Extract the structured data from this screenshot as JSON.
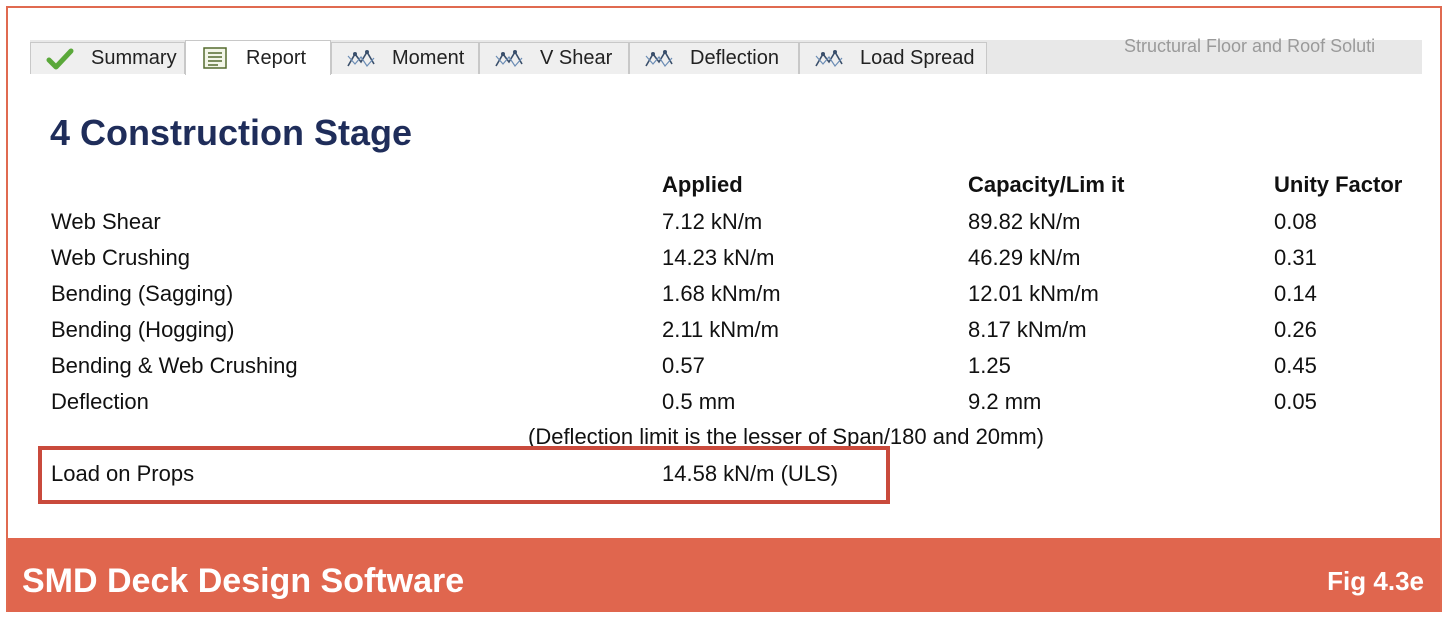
{
  "tabs": [
    {
      "label": "Summary",
      "icon": "checkmark-icon"
    },
    {
      "label": "Report",
      "icon": "report-icon"
    },
    {
      "label": "Moment",
      "icon": "graph-icon"
    },
    {
      "label": "V Shear",
      "icon": "graph-icon"
    },
    {
      "label": "Deflection",
      "icon": "graph-icon"
    },
    {
      "label": "Load Spread",
      "icon": "graph-icon"
    }
  ],
  "active_tab": "Report",
  "brand_text": "Structural Floor and Roof Soluti",
  "report": {
    "title": "4 Construction Stage",
    "columns": {
      "applied": "Applied",
      "capacity": "Capacity/Lim it",
      "unity": "Unity Factor"
    },
    "rows": [
      {
        "name": "Web Shear",
        "applied": "7.12 kN/m",
        "capacity": "89.82 kN/m",
        "unity": "0.08"
      },
      {
        "name": "Web Crushing",
        "applied": "14.23 kN/m",
        "capacity": "46.29 kN/m",
        "unity": "0.31"
      },
      {
        "name": "Bending (Sagging)",
        "applied": "1.68 kNm/m",
        "capacity": "12.01 kNm/m",
        "unity": "0.14"
      },
      {
        "name": "Bending (Hogging)",
        "applied": "2.11 kNm/m",
        "capacity": "8.17 kNm/m",
        "unity": "0.26"
      },
      {
        "name": "Bending & Web Crushing",
        "applied": "0.57",
        "capacity": "1.25",
        "unity": "0.45"
      },
      {
        "name": "Deflection",
        "applied": "0.5 mm",
        "capacity": "9.2 mm",
        "unity": "0.05"
      }
    ],
    "note": "(Deflection limit is the lesser of Span/180 and 20mm)",
    "props": {
      "name": "Load on Props",
      "value": "14.58 kN/m (ULS)"
    }
  },
  "footer": {
    "title": "SMD Deck Design Software",
    "fig": "Fig 4.3e"
  },
  "colors": {
    "accent": "#e0664e",
    "heading": "#1f2d5a",
    "highlight": "#c94a3c"
  }
}
